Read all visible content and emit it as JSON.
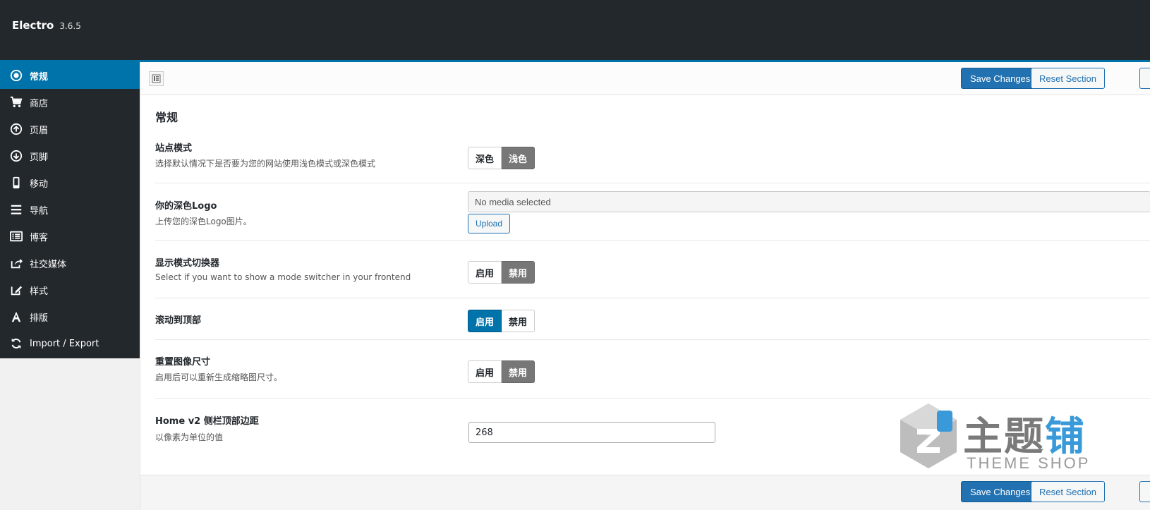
{
  "app": {
    "name": "Electro",
    "version": "3.6.5"
  },
  "sidebar": {
    "items": [
      {
        "label": "常规",
        "icon": "radio-circle-icon",
        "active": true
      },
      {
        "label": "商店",
        "icon": "cart-icon"
      },
      {
        "label": "页眉",
        "icon": "arrow-up-circle-icon"
      },
      {
        "label": "页脚",
        "icon": "arrow-down-circle-icon"
      },
      {
        "label": "移动",
        "icon": "mobile-icon"
      },
      {
        "label": "导航",
        "icon": "menu-icon"
      },
      {
        "label": "博客",
        "icon": "list-icon"
      },
      {
        "label": "社交媒体",
        "icon": "share-icon"
      },
      {
        "label": "样式",
        "icon": "edit-icon"
      },
      {
        "label": "排版",
        "icon": "font-icon"
      },
      {
        "label": "Import / Export",
        "icon": "refresh-icon"
      }
    ]
  },
  "toolbar": {
    "save_label": "Save Changes",
    "reset_label": "Reset Section"
  },
  "section": {
    "title": "常规"
  },
  "fields": {
    "site_mode": {
      "label": "站点模式",
      "desc": "选择默认情况下是否要为您的网站使用浅色模式或深色模式",
      "options": [
        "深色",
        "浅色"
      ],
      "selected": "浅色"
    },
    "dark_logo": {
      "label": "你的深色Logo",
      "desc": "上传您的深色Logo图片。",
      "value": "No media selected",
      "upload_label": "Upload"
    },
    "mode_switcher": {
      "label": "显示模式切换器",
      "desc": "Select if you want to show a mode switcher in your frontend",
      "options": [
        "启用",
        "禁用"
      ],
      "selected": "禁用"
    },
    "scroll_top": {
      "label": "滚动到顶部",
      "options": [
        "启用",
        "禁用"
      ],
      "selected": "启用"
    },
    "regen_images": {
      "label": "重置图像尺寸",
      "desc": "启用后可以重新生成缩略图尺寸。",
      "options": [
        "启用",
        "禁用"
      ],
      "selected": "禁用"
    },
    "home_v2_margin": {
      "label": "Home v2 侧栏顶部边距",
      "desc": "以像素为单位的值",
      "value": "268"
    }
  },
  "watermark": {
    "text_gray": "主题",
    "text_blue": "铺",
    "sub": "THEME SHOP"
  },
  "colors": {
    "accent": "#0073aa",
    "topbar": "#23282d",
    "primary_button": "#2271b1"
  }
}
